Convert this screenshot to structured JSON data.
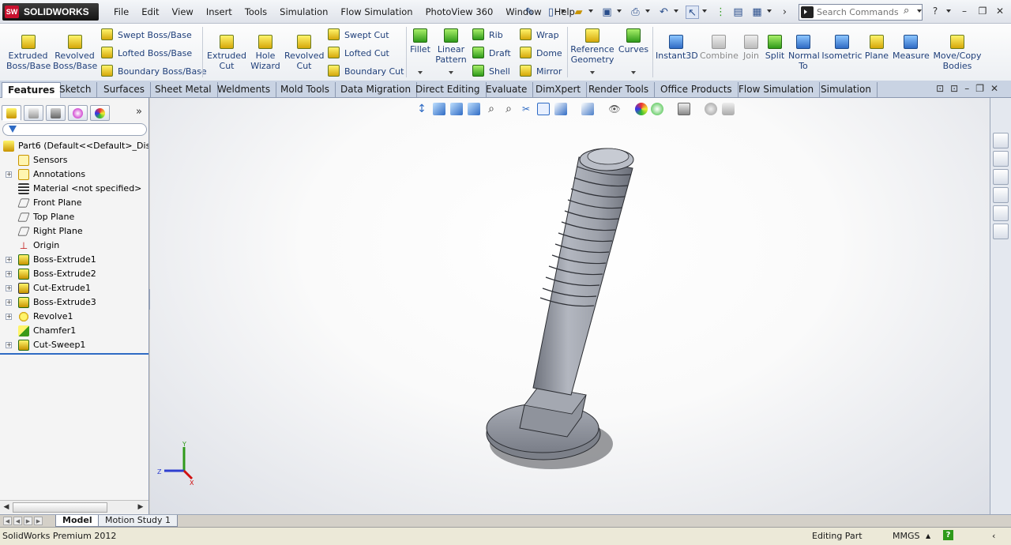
{
  "app": {
    "brand": "SOLIDWORKS",
    "brand_mark": "SW",
    "version_text": "SolidWorks Premium 2012"
  },
  "menu": [
    "File",
    "Edit",
    "View",
    "Insert",
    "Tools",
    "Simulation",
    "Flow Simulation",
    "PhotoView 360",
    "Window",
    "Help"
  ],
  "search": {
    "placeholder": "Search Commands"
  },
  "ribbon": {
    "extruded_boss": "Extruded Boss/Base",
    "revolved_boss": "Revolved Boss/Base",
    "swept_boss": "Swept Boss/Base",
    "lofted_boss": "Lofted Boss/Base",
    "boundary_boss": "Boundary Boss/Base",
    "extruded_cut": "Extruded Cut",
    "hole_wizard": "Hole Wizard",
    "revolved_cut": "Revolved Cut",
    "swept_cut": "Swept Cut",
    "lofted_cut": "Lofted Cut",
    "boundary_cut": "Boundary Cut",
    "fillet": "Fillet",
    "linear_pattern": "Linear Pattern",
    "rib": "Rib",
    "draft": "Draft",
    "shell": "Shell",
    "wrap": "Wrap",
    "dome": "Dome",
    "mirror": "Mirror",
    "reference_geometry": "Reference Geometry",
    "curves": "Curves",
    "instant3d": "Instant3D",
    "combine": "Combine",
    "join": "Join",
    "split": "Split",
    "normal_to": "Normal To",
    "isometric": "Isometric",
    "plane": "Plane",
    "measure": "Measure",
    "move_copy": "Move/Copy Bodies"
  },
  "tabs": [
    "Features",
    "Sketch",
    "Surfaces",
    "Sheet Metal",
    "Weldments",
    "Mold Tools",
    "Data Migration",
    "Direct Editing",
    "Evaluate",
    "DimXpert",
    "Render Tools",
    "Office Products",
    "Flow Simulation",
    "Simulation"
  ],
  "tree": {
    "root": "Part6  (Default<<Default>_Display State 1>)",
    "items": [
      "Sensors",
      "Annotations",
      "Material <not specified>",
      "Front Plane",
      "Top Plane",
      "Right Plane",
      "Origin",
      "Boss-Extrude1",
      "Boss-Extrude2",
      "Cut-Extrude1",
      "Boss-Extrude3",
      "Revolve1",
      "Chamfer1",
      "Cut-Sweep1"
    ]
  },
  "triad": {
    "y": "Y",
    "z": "Z",
    "x": "X"
  },
  "bottom_tabs": [
    "Model",
    "Motion Study 1"
  ],
  "status": {
    "mode": "Editing Part",
    "units": "MMGS",
    "help": "?"
  },
  "colors": {
    "accent": "#2f6bc4",
    "brand_red": "#c8102e",
    "bolt": "#9ca0ab"
  }
}
